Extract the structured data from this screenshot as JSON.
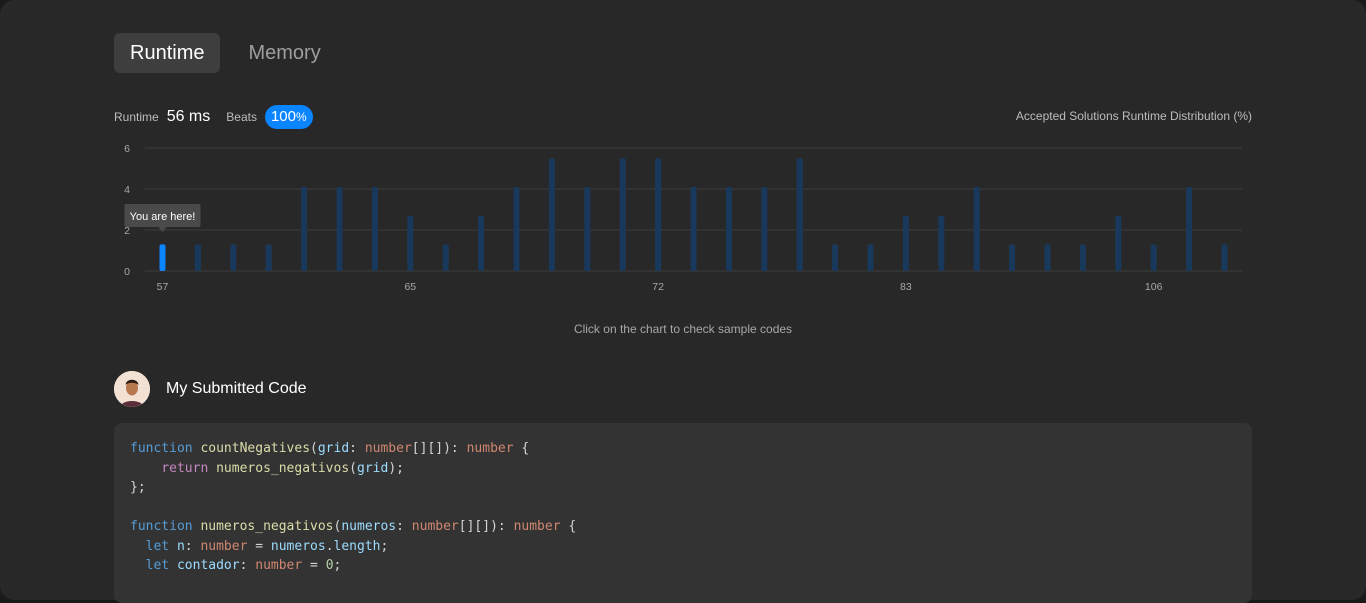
{
  "tabs": [
    {
      "label": "Runtime",
      "active": true
    },
    {
      "label": "Memory",
      "active": false
    }
  ],
  "stats": {
    "runtime_label": "Runtime",
    "runtime_value": "56 ms",
    "beats_label": "Beats",
    "beats_value": "100",
    "beats_unit": "%"
  },
  "distribution_label": "Accepted Solutions Runtime Distribution (%)",
  "chart_data": {
    "type": "bar",
    "y_ticks": [
      "6",
      "4",
      "2",
      "0"
    ],
    "ylim": [
      0,
      6
    ],
    "x_tick_labels": [
      "57",
      "65",
      "72",
      "83",
      "106"
    ],
    "x_tick_bar_index": [
      0,
      7,
      14,
      21,
      28
    ],
    "values": [
      1.3,
      1.3,
      1.3,
      1.3,
      4.1,
      4.1,
      4.1,
      2.7,
      1.3,
      2.7,
      4.1,
      5.5,
      4.1,
      5.5,
      5.5,
      4.1,
      4.1,
      4.1,
      5.5,
      1.3,
      1.3,
      2.7,
      2.7,
      4.1,
      1.3,
      1.3,
      1.3,
      2.7,
      1.3,
      4.1,
      1.3
    ],
    "highlight_index": 0,
    "tooltip": "You are here!",
    "colors": {
      "bar": "#19395c",
      "highlight": "#0a84ff",
      "grid": "#3c3c3c"
    }
  },
  "hint": "Click on the chart to check sample codes",
  "submitted_title": "My Submitted Code",
  "code_lines": [
    [
      [
        "kw",
        "function"
      ],
      [
        "",
        "​ "
      ],
      [
        "fn",
        "countNegatives"
      ],
      [
        "",
        "("
      ],
      [
        "var",
        "grid"
      ],
      [
        "",
        ": "
      ],
      [
        "ty",
        "number"
      ],
      [
        "",
        "[][]): "
      ],
      [
        "ty",
        "number"
      ],
      [
        "",
        " {"
      ]
    ],
    [
      [
        "",
        "    "
      ],
      [
        "kw2",
        "return"
      ],
      [
        "",
        " "
      ],
      [
        "fn",
        "numeros_negativos"
      ],
      [
        "",
        "("
      ],
      [
        "var",
        "grid"
      ],
      [
        "",
        ");"
      ]
    ],
    [
      [
        "",
        "};"
      ]
    ],
    [
      [
        "",
        ""
      ]
    ],
    [
      [
        "kw",
        "function"
      ],
      [
        "",
        " "
      ],
      [
        "fn",
        "numeros_negativos"
      ],
      [
        "",
        "("
      ],
      [
        "var",
        "numeros"
      ],
      [
        "",
        ": "
      ],
      [
        "ty",
        "number"
      ],
      [
        "",
        "[][]): "
      ],
      [
        "ty",
        "number"
      ],
      [
        "",
        " {"
      ]
    ],
    [
      [
        "",
        "  "
      ],
      [
        "kw",
        "let"
      ],
      [
        "",
        " "
      ],
      [
        "var",
        "n"
      ],
      [
        "",
        ": "
      ],
      [
        "ty",
        "number"
      ],
      [
        "",
        " = "
      ],
      [
        "var",
        "numeros"
      ],
      [
        "",
        "."
      ],
      [
        "var",
        "length"
      ],
      [
        "",
        ";"
      ]
    ],
    [
      [
        "",
        "  "
      ],
      [
        "kw",
        "let"
      ],
      [
        "",
        " "
      ],
      [
        "var",
        "contador"
      ],
      [
        "",
        ": "
      ],
      [
        "ty",
        "number"
      ],
      [
        "",
        " = "
      ],
      [
        "num",
        "0"
      ],
      [
        "",
        ";"
      ]
    ]
  ]
}
